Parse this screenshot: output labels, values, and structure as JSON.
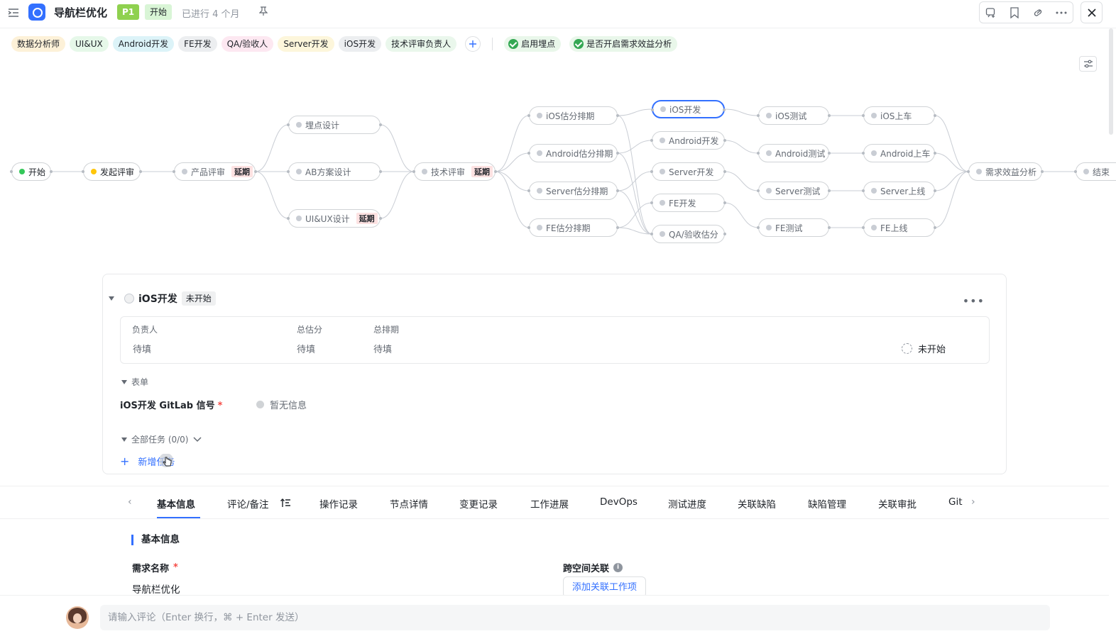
{
  "header": {
    "title": "导航栏优化",
    "priority": "P1",
    "status": "开始",
    "duration": "已进行 4 个月"
  },
  "roles": [
    {
      "label": "数据分析师",
      "bg": "#fdf1d8"
    },
    {
      "label": "UI&UX",
      "bg": "#e6f8e9"
    },
    {
      "label": "Android开发",
      "bg": "#dcf3f8"
    },
    {
      "label": "FE开发",
      "bg": "#eceef0"
    },
    {
      "label": "QA/验收人",
      "bg": "#fde8f1"
    },
    {
      "label": "Server开发",
      "bg": "#fdf6db"
    },
    {
      "label": "iOS开发",
      "bg": "#eceef0"
    },
    {
      "label": "技术评审负责人",
      "bg": "#eaf7ec"
    }
  ],
  "flags": [
    "启用埋点",
    "是否开启需求效益分析"
  ],
  "flow": {
    "nodes": [
      {
        "id": "start",
        "label": "开始",
        "dot": "#34c759"
      },
      {
        "id": "review_start",
        "label": "发起评审",
        "dot": "#ffc60a"
      },
      {
        "id": "product_review",
        "label": "产品评审",
        "delay": "延期"
      },
      {
        "id": "tracking_design",
        "label": "埋点设计"
      },
      {
        "id": "ab_design",
        "label": "AB方案设计"
      },
      {
        "id": "uiux_design",
        "label": "UI&UX设计",
        "delay": "延期"
      },
      {
        "id": "tech_review",
        "label": "技术评审",
        "delay": "延期"
      },
      {
        "id": "ios_estimate",
        "label": "iOS估分排期"
      },
      {
        "id": "android_estimate",
        "label": "Android估分排期"
      },
      {
        "id": "server_estimate",
        "label": "Server估分排期"
      },
      {
        "id": "fe_estimate",
        "label": "FE估分排期"
      },
      {
        "id": "ios_dev",
        "label": "iOS开发"
      },
      {
        "id": "android_dev",
        "label": "Android开发"
      },
      {
        "id": "server_dev",
        "label": "Server开发"
      },
      {
        "id": "fe_dev",
        "label": "FE开发"
      },
      {
        "id": "qa_estimate",
        "label": "QA/验收估分"
      },
      {
        "id": "ios_test",
        "label": "iOS测试"
      },
      {
        "id": "android_test",
        "label": "Android测试"
      },
      {
        "id": "server_test",
        "label": "Server测试"
      },
      {
        "id": "fe_test",
        "label": "FE测试"
      },
      {
        "id": "ios_release",
        "label": "iOS上车"
      },
      {
        "id": "android_release",
        "label": "Android上车"
      },
      {
        "id": "server_release",
        "label": "Server上线"
      },
      {
        "id": "fe_release",
        "label": "FE上线"
      },
      {
        "id": "benefit",
        "label": "需求效益分析"
      },
      {
        "id": "end",
        "label": "结束"
      }
    ],
    "edges": [
      [
        "start",
        "review_start"
      ],
      [
        "review_start",
        "product_review"
      ],
      [
        "product_review",
        "tracking_design"
      ],
      [
        "product_review",
        "ab_design"
      ],
      [
        "product_review",
        "uiux_design"
      ],
      [
        "tracking_design",
        "tech_review"
      ],
      [
        "ab_design",
        "tech_review"
      ],
      [
        "uiux_design",
        "tech_review"
      ],
      [
        "tech_review",
        "ios_estimate"
      ],
      [
        "tech_review",
        "android_estimate"
      ],
      [
        "tech_review",
        "server_estimate"
      ],
      [
        "tech_review",
        "fe_estimate"
      ],
      [
        "ios_estimate",
        "ios_dev"
      ],
      [
        "android_estimate",
        "android_dev"
      ],
      [
        "server_estimate",
        "server_dev"
      ],
      [
        "fe_estimate",
        "fe_dev"
      ],
      [
        "ios_estimate",
        "qa_estimate"
      ],
      [
        "android_estimate",
        "qa_estimate"
      ],
      [
        "server_estimate",
        "qa_estimate"
      ],
      [
        "fe_estimate",
        "qa_estimate"
      ],
      [
        "ios_dev",
        "ios_test"
      ],
      [
        "android_dev",
        "android_test"
      ],
      [
        "server_dev",
        "server_test"
      ],
      [
        "fe_dev",
        "fe_test"
      ],
      [
        "ios_test",
        "ios_release"
      ],
      [
        "android_test",
        "android_release"
      ],
      [
        "server_test",
        "server_release"
      ],
      [
        "fe_test",
        "fe_release"
      ],
      [
        "ios_release",
        "benefit"
      ],
      [
        "android_release",
        "benefit"
      ],
      [
        "server_release",
        "benefit"
      ],
      [
        "fe_release",
        "benefit"
      ],
      [
        "benefit",
        "end"
      ]
    ],
    "active": "ios_dev"
  },
  "detail": {
    "title": "iOS开发",
    "status": "未开始",
    "owner_label": "负责人",
    "owner_value": "待填",
    "estimate_label": "总估分",
    "estimate_value": "待填",
    "schedule_label": "总排期",
    "schedule_value": "待填",
    "state": "未开始",
    "form_section": "表单",
    "field_label": "iOS开发 GitLab 信号",
    "field_value": "暂无信息",
    "tasks_section": "全部任务 (0/0)",
    "add_task": "新增任务"
  },
  "tabs": [
    "基本信息",
    "评论/备注",
    "操作记录",
    "节点详情",
    "变更记录",
    "工作进展",
    "DevOps",
    "测试进度",
    "关联缺陷",
    "缺陷管理",
    "关联审批",
    "Git"
  ],
  "basic_info": {
    "section_title": "基本信息",
    "name_label": "需求名称",
    "name_value": "导航栏优化",
    "cross_label": "跨空间关联",
    "cross_button": "添加关联工作项"
  },
  "comment": {
    "placeholder": "请输入评论（Enter 换行，⌘ + Enter 发送）"
  }
}
